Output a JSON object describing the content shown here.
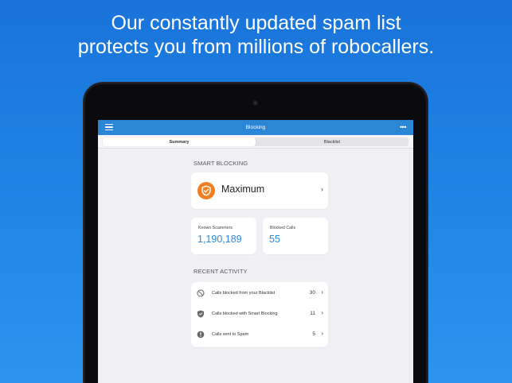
{
  "headline": {
    "line1": "Our constantly updated spam list",
    "line2": "protects you from millions of robocallers."
  },
  "navbar": {
    "title": "Blocking",
    "menu_icon": "hamburger-menu-icon",
    "more_icon": "more-dots-icon",
    "more_glyph": "•••",
    "color": "#2c86d6"
  },
  "tabs": [
    {
      "label": "Summary",
      "active": true
    },
    {
      "label": "Blacklist",
      "active": false
    }
  ],
  "smart_blocking": {
    "heading": "SMART BLOCKING",
    "level": "Maximum",
    "icon": "shield-check-icon",
    "icon_color": "#f17f22",
    "chevron": "›"
  },
  "stats": [
    {
      "label": "Known Scammers",
      "value": "1,190,189"
    },
    {
      "label": "Blocked Calls",
      "value": "55"
    }
  ],
  "recent_activity": {
    "heading": "RECENT ACTIVITY",
    "items": [
      {
        "label": "Calls blocked from your Blacklist",
        "count": "30",
        "icon": "blocked-circle-icon"
      },
      {
        "label": "Calls blocked with Smart Blocking",
        "count": "11",
        "icon": "shield-icon"
      },
      {
        "label": "Calls sent to Spam",
        "count": "5",
        "icon": "alert-exclamation-icon"
      }
    ],
    "chevron": "›"
  },
  "colors": {
    "background_top": "#1a73d9",
    "background_bottom": "#2a94ee",
    "accent_value": "#2a8ae0"
  }
}
